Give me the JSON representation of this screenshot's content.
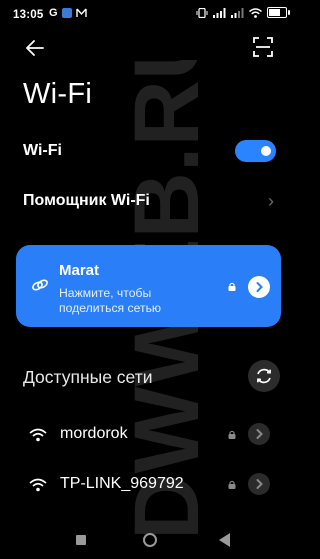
{
  "status_bar": {
    "time": "13:05",
    "carrier_glyph": "G",
    "icons_left": [
      "app-notification-icon",
      "mail-icon"
    ],
    "icons_right": [
      "vibrate-icon",
      "signal-icon",
      "signal-icon",
      "wifi-icon",
      "battery-icon"
    ]
  },
  "header": {
    "back_icon": "arrow-left-icon",
    "scan_icon": "qr-scan-icon",
    "title": "Wi-Fi"
  },
  "wifi_toggle": {
    "label": "Wi-Fi",
    "enabled": true
  },
  "assistant": {
    "label": "Помощник Wi-Fi"
  },
  "connected": {
    "name": "Marat",
    "subtitle": "Нажмите, чтобы поделиться сетью",
    "icon": "share-link-icon",
    "locked": true
  },
  "available": {
    "label": "Доступные сети",
    "networks": [
      {
        "name": "mordorok",
        "locked": true
      },
      {
        "name": "TP-LINK_969792",
        "locked": true
      }
    ]
  },
  "watermark": "DWWEB.RU",
  "colors": {
    "accent": "#2a83ff",
    "card": "#2a7ff8",
    "background": "#000000"
  }
}
